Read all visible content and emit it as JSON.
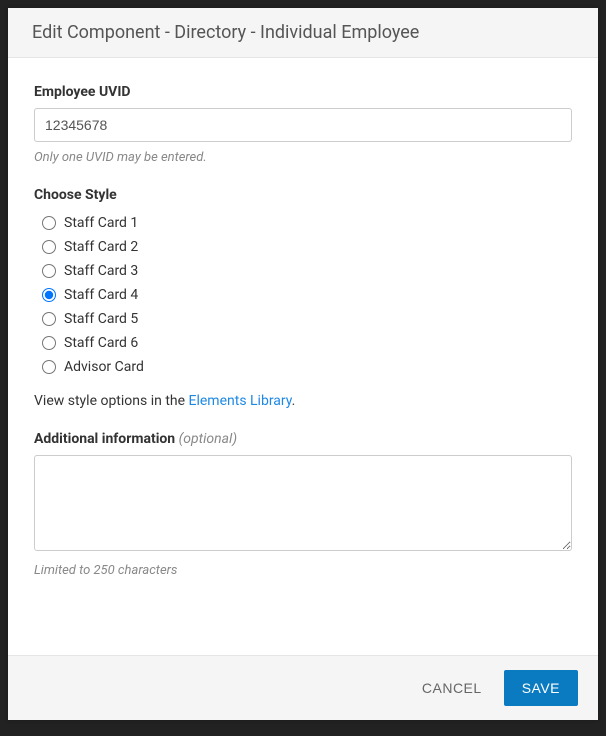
{
  "header": {
    "title": "Edit Component - Directory - Individual Employee"
  },
  "uvid": {
    "label": "Employee UVID",
    "value": "12345678",
    "help": "Only one UVID may be entered."
  },
  "style": {
    "label": "Choose Style",
    "options": [
      {
        "label": "Staff Card 1",
        "selected": false
      },
      {
        "label": "Staff Card 2",
        "selected": false
      },
      {
        "label": "Staff Card 3",
        "selected": false
      },
      {
        "label": "Staff Card 4",
        "selected": true
      },
      {
        "label": "Staff Card 5",
        "selected": false
      },
      {
        "label": "Staff Card 6",
        "selected": false
      },
      {
        "label": "Advisor Card",
        "selected": false
      }
    ],
    "note_prefix": "View style options in the ",
    "link_text": "Elements Library",
    "note_suffix": "."
  },
  "additional": {
    "label": "Additional information",
    "optional": "(optional)",
    "value": "",
    "help": "Limited to 250 characters"
  },
  "footer": {
    "cancel": "CANCEL",
    "save": "SAVE"
  }
}
